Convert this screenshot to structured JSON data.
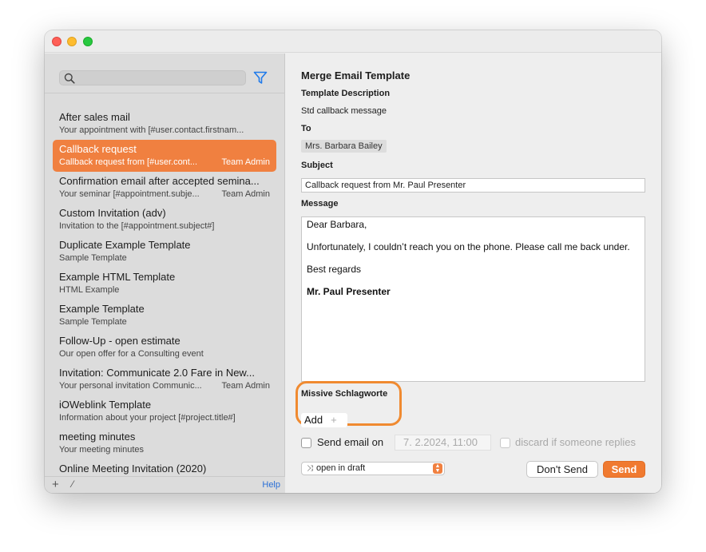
{
  "search": {
    "placeholder": ""
  },
  "templates": [
    {
      "title": "After sales mail",
      "desc": "Your appointment with [#user.contact.firstnam...",
      "owner": "",
      "selected": false
    },
    {
      "title": "Callback request",
      "desc": "Callback request from [#user.cont...",
      "owner": "Team Admin",
      "selected": true
    },
    {
      "title": "Confirmation email after accepted semina...",
      "desc": "Your seminar [#appointment.subje...",
      "owner": "Team Admin",
      "selected": false
    },
    {
      "title": "Custom Invitation (adv)",
      "desc": "Invitation to the [#appointment.subject#]",
      "owner": "",
      "selected": false
    },
    {
      "title": "Duplicate Example Template",
      "desc": "Sample Template",
      "owner": "",
      "selected": false
    },
    {
      "title": "Example HTML Template",
      "desc": "HTML Example",
      "owner": "",
      "selected": false
    },
    {
      "title": "Example Template",
      "desc": "Sample Template",
      "owner": "",
      "selected": false
    },
    {
      "title": "Follow-Up - open estimate",
      "desc": "Our open offer for a Consulting event",
      "owner": "",
      "selected": false
    },
    {
      "title": "Invitation: Communicate 2.0 Fare in New...",
      "desc": "Your personal invitation Communic...",
      "owner": "Team Admin",
      "selected": false
    },
    {
      "title": "iOWeblink Template",
      "desc": "Information about your project [#project.title#]",
      "owner": "",
      "selected": false
    },
    {
      "title": "meeting minutes",
      "desc": "Your meeting minutes",
      "owner": "",
      "selected": false
    },
    {
      "title": "Online Meeting Invitation (2020)",
      "desc": "",
      "owner": "",
      "selected": false
    }
  ],
  "sidebar_footer": {
    "add": "+",
    "edit": "⁄",
    "help": "Help"
  },
  "main": {
    "title": "Merge Email Template",
    "template_description_label": "Template Description",
    "template_description": "Std callback message",
    "to_label": "To",
    "to_recipient": "Mrs. Barbara Bailey",
    "subject_label": "Subject",
    "subject": "Callback request from Mr. Paul Presenter",
    "message_label": "Message",
    "message": {
      "greeting": "Dear  Barbara,",
      "body": "Unfortunately, I couldn’t reach you on the phone. Please call me back under.",
      "closing": "Best regards",
      "signature": "Mr. Paul Presenter"
    },
    "tags_label": "Missive Schlagworte",
    "tags_add": "Add",
    "tags_add_plus": "+",
    "send_on_label": "Send email on",
    "send_on_date": "7. 2.2024, 11:00",
    "discard_label": "discard if someone replies",
    "draft_option": "open in draft",
    "dont_send": "Don't Send",
    "send": "Send"
  },
  "colors": {
    "accent": "#f07a30",
    "selection": "#f08040",
    "link": "#2a6fd6"
  }
}
